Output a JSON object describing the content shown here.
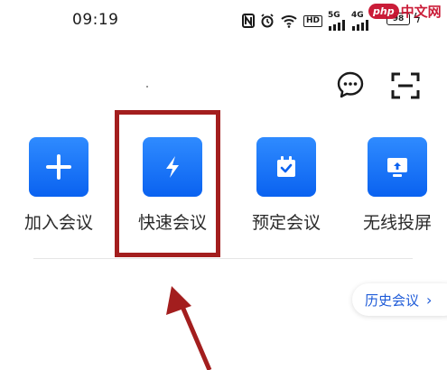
{
  "status_bar": {
    "time": "09:19",
    "network_labels": [
      "HD",
      "5G",
      "4G"
    ],
    "battery": "98"
  },
  "watermark": {
    "logo": "php",
    "text": "中文网"
  },
  "actions": [
    {
      "label": "加入会议",
      "icon": "plus-icon"
    },
    {
      "label": "快速会议",
      "icon": "lightning-icon"
    },
    {
      "label": "预定会议",
      "icon": "calendar-check-icon"
    },
    {
      "label": "无线投屏",
      "icon": "screen-cast-icon"
    }
  ],
  "history": {
    "label": "历史会议",
    "chevron": "›"
  },
  "colors": {
    "accent": "#0a62f0",
    "highlight": "#a31e1e",
    "history_text": "#1e5bd8"
  }
}
